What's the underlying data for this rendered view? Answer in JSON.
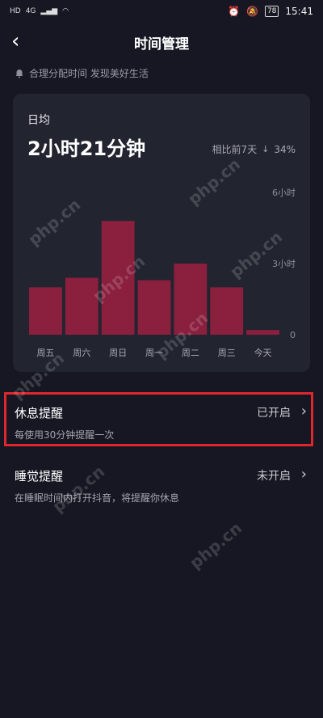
{
  "status_bar": {
    "left_info": [
      "HD",
      "4G",
      "HD",
      "4G"
    ],
    "battery": "78",
    "time": "15:41"
  },
  "nav": {
    "title": "时间管理",
    "back_icon": "chevron-left-icon"
  },
  "tip": {
    "text": "合理分配时间 发现美好生活",
    "icon": "bell-icon"
  },
  "card": {
    "avg_label": "日均",
    "avg_value": "2小时21分钟",
    "compare_label": "相比前7天",
    "compare_value": "34%",
    "compare_direction": "down"
  },
  "chart_data": {
    "type": "bar",
    "categories": [
      "周五",
      "周六",
      "周日",
      "周一",
      "周二",
      "周三",
      "今天"
    ],
    "values": [
      2.0,
      2.4,
      4.8,
      2.3,
      3.0,
      2.0,
      0.2
    ],
    "ylim": [
      0,
      6
    ],
    "y_tick_labels": [
      "6小时",
      "3小时",
      "0"
    ],
    "bar_color": "#8a1f3e"
  },
  "rest_reminder": {
    "title": "休息提醒",
    "subtitle": "每使用30分钟提醒一次",
    "status": "已开启"
  },
  "sleep_reminder": {
    "title": "睡觉提醒",
    "subtitle": "在睡眠时间内打开抖音，将提醒你休息",
    "status": "未开启"
  },
  "watermark": "php.cn"
}
